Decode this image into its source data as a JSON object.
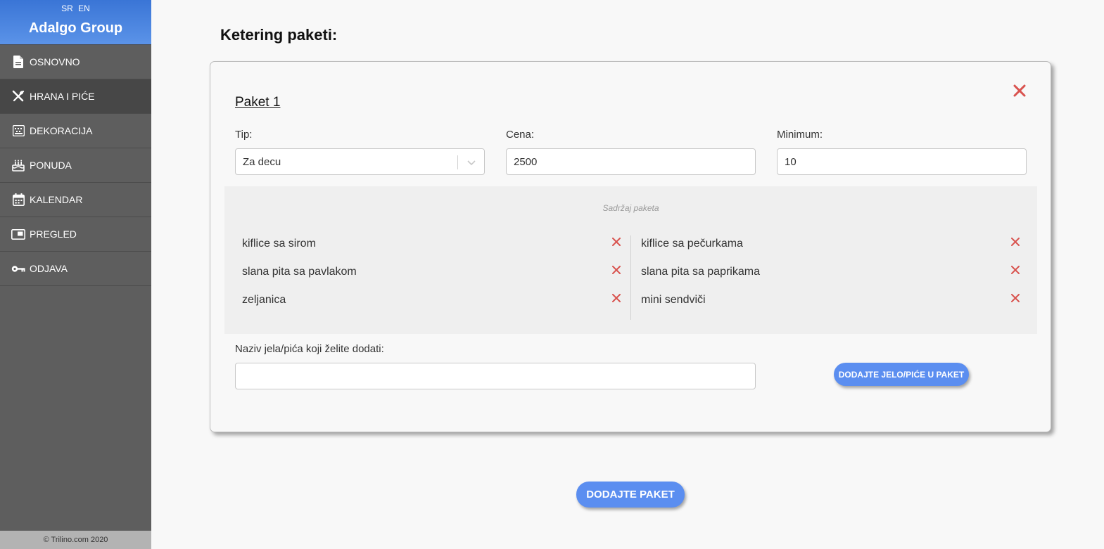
{
  "sidebar": {
    "languages": [
      "SR",
      "EN"
    ],
    "brand": "Adalgo Group",
    "items": [
      {
        "label": "OSNOVNO",
        "icon": "document-icon",
        "active": false
      },
      {
        "label": "HRANA I PIĆE",
        "icon": "utensils-icon",
        "active": true
      },
      {
        "label": "DEKORACIJA",
        "icon": "decoration-icon",
        "active": false
      },
      {
        "label": "PONUDA",
        "icon": "cake-icon",
        "active": false
      },
      {
        "label": "KALENDAR",
        "icon": "calendar-icon",
        "active": false
      },
      {
        "label": "PREGLED",
        "icon": "preview-icon",
        "active": false
      },
      {
        "label": "ODJAVA",
        "icon": "key-icon",
        "active": false
      }
    ],
    "footer": "© Trilino.com 2020"
  },
  "main": {
    "title": "Ketering paketi:",
    "package": {
      "title": "Paket 1",
      "type_label": "Tip:",
      "type_value": "Za decu",
      "price_label": "Cena:",
      "price_value": "2500",
      "minimum_label": "Minimum:",
      "minimum_value": "10",
      "contents_title": "Sadržaj paketa",
      "left_items": [
        "kiflice sa sirom",
        "slana pita sa pavlakom",
        "zeljanica"
      ],
      "right_items": [
        "kiflice sa pečurkama",
        "slana pita sa paprikama",
        "mini sendviči"
      ],
      "add_label": "Naziv jela/pića koji želite dodati:",
      "add_input_value": "",
      "add_button": "DODAJTE JELO/PIĆE U PAKET"
    },
    "add_package_button": "DODAJTE PAKET"
  },
  "colors": {
    "accent": "#5b8ef0",
    "remove": "#d9534f",
    "sidebar_bg": "#5e5e5e",
    "sidebar_active": "#474747"
  }
}
